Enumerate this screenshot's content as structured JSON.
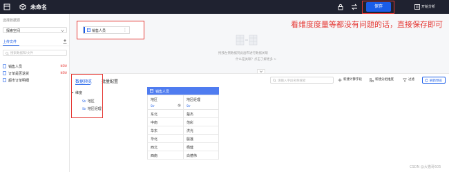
{
  "app": {
    "title": "未命名",
    "save_label": "保存",
    "analysis_label": "开始分析"
  },
  "sidebar": {
    "section_label": "选择数据源",
    "datasource_value": "探索空间",
    "upload_label": "上传文件",
    "search_placeholder": "搜索数据和/文件",
    "files": [
      {
        "label": "销售人员",
        "tag": "NEW"
      },
      {
        "label": "订单是否退货",
        "tag": "NEW"
      },
      {
        "label": "超市订单明细",
        "tag": ""
      }
    ]
  },
  "canvas": {
    "field_label": "销售人员",
    "annotation": "看维度度量等都没有问题的话，直接保存即可",
    "empty_text": "拖拽左侧数据到此画布进行数据关联",
    "empty_help": "什么是关联？点击了解更多 >"
  },
  "bottom": {
    "tabs": [
      "数据预览",
      "批量配置"
    ],
    "tree_root": "维度",
    "tree_items": [
      "地区",
      "地区经理"
    ],
    "search_placeholder": "请输入字段名称搜索",
    "tools": [
      "新建计算字段",
      "新建分组维度",
      "过滤"
    ],
    "refresh_label": "刷新预览"
  },
  "table": {
    "name": "销售人员",
    "columns": [
      {
        "name": "地区",
        "type": "Str"
      },
      {
        "name": "地区经理",
        "type": "Str"
      }
    ],
    "rows": [
      [
        "东北",
        "楚杰"
      ],
      [
        "中南",
        "范彩"
      ],
      [
        "华东",
        "洪光"
      ],
      [
        "华北",
        "殷莲"
      ],
      [
        "西北",
        "杨健"
      ],
      [
        "西南",
        "白德伟"
      ]
    ]
  },
  "watermark": "CSDN @大猫哥605",
  "colors": {
    "topbar": "#1f2230",
    "accent": "#1a5de8",
    "annotation": "#e53935",
    "table_header": "#4f7cf0"
  }
}
